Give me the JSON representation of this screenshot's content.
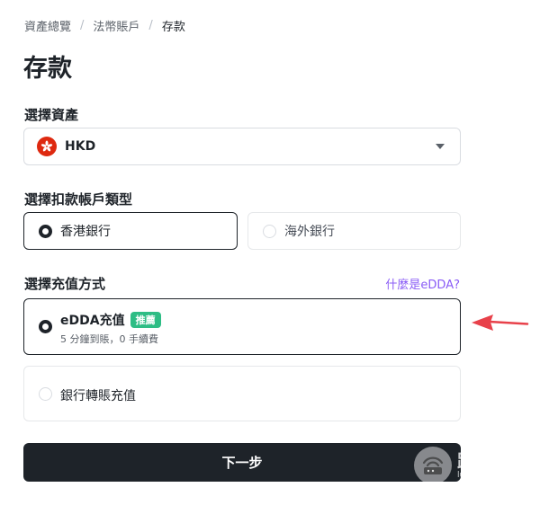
{
  "breadcrumb": {
    "items": [
      "資產總覽",
      "法幣賬戶",
      "存款"
    ],
    "separator": "/"
  },
  "page": {
    "title": "存款"
  },
  "asset": {
    "label": "選擇資產",
    "selected": "HKD",
    "flag_icon": "hong-kong-flag-icon"
  },
  "account_type": {
    "label": "選擇扣款帳戶類型",
    "options": [
      {
        "label": "香港銀行",
        "selected": true
      },
      {
        "label": "海外銀行",
        "selected": false
      }
    ]
  },
  "method": {
    "label": "選擇充值方式",
    "help_link": "什麼是eDDA?",
    "options": [
      {
        "title": "eDDA充值",
        "badge": "推薦",
        "subtitle": "5 分鐘到賬，0 手續費",
        "selected": true
      },
      {
        "title": "銀行轉賬充值",
        "selected": false
      }
    ]
  },
  "actions": {
    "next": "下一步"
  },
  "watermark": {
    "text": "路由器",
    "url": "luyouqi.com"
  },
  "colors": {
    "primary": "#1e2329",
    "accent_link": "#8a5cf6",
    "badge": "#2ebd85",
    "annotation": "#e8414a",
    "flag_red": "#de2910"
  }
}
